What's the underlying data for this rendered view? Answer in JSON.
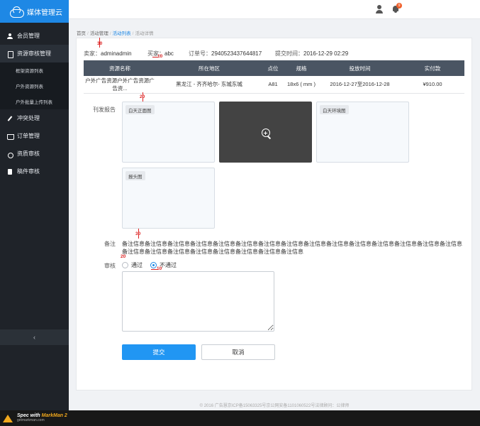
{
  "app": {
    "title": "媒体管理云"
  },
  "sidebar": {
    "items": [
      {
        "label": "会员管理",
        "icon": "user-icon"
      },
      {
        "label": "资源审核管理",
        "icon": "doc-icon"
      },
      {
        "label": "冲突处理",
        "icon": "pen-icon"
      },
      {
        "label": "订单管理",
        "icon": "cart-icon"
      },
      {
        "label": "资质审核",
        "icon": "medal-icon"
      },
      {
        "label": "稿件审核",
        "icon": "file-icon"
      }
    ],
    "sub_items": [
      "框架资源列表",
      "户外资源列表",
      "户外批量上传列表"
    ],
    "collapse_glyph": "‹"
  },
  "topbar": {
    "badge_count": "9"
  },
  "breadcrumb": {
    "home": "首页",
    "level1": "活动管理",
    "level2": "活动列表",
    "level3": "活动详情"
  },
  "order_info": {
    "seller_label": "卖家：",
    "seller": "adminadmin",
    "buyer_label": "买家：",
    "buyer": "abc",
    "order_no_label": "订单号：",
    "order_no": "2940523437644817",
    "submit_time_label": "提交时间：",
    "submit_time": "2016-12-29 02:29"
  },
  "table": {
    "headers": [
      "资源名称",
      "所在地区",
      "点位",
      "规格",
      "投放时间",
      "实付款"
    ],
    "rows": [
      [
        "户外广告资源户外广告资源广告资...",
        "黑龙江 - 齐齐哈尔- 东城东城",
        "A81",
        "18x6 ( mm )",
        "2016-12-27至2016-12-28",
        "¥910.00"
      ]
    ]
  },
  "report": {
    "label": "刊发报告",
    "images": [
      {
        "tag": "白天正面图"
      },
      {
        "tag": ""
      },
      {
        "tag": "白天环境图"
      },
      {
        "tag": "报头图"
      }
    ]
  },
  "remark": {
    "label": "备注",
    "text": "备注信息备注信息备注信息备注信息备注信息备注信息备注信息备注信息备注信息备注信息备注信息备注信息备注信息备注信息备注信息备注信息备注信息备注信息备注信息备注信息备注信息备注信息备注信息"
  },
  "review": {
    "label": "审核",
    "options": [
      "通过",
      "不通过"
    ],
    "selected": "不通过"
  },
  "buttons": {
    "submit": "提交",
    "cancel": "取消"
  },
  "footer": {
    "text": "© 2016 广告慧京ICP备15063325号京公网安备1101060522号法律顾问：公律师"
  },
  "annotations": {
    "a30_top": "30",
    "a10_top": "10",
    "a20_report": "20",
    "a30_mid": "30",
    "a20_review": "20",
    "a10_review": "10"
  },
  "markman": {
    "spec_with": "Spec with",
    "brand": "MarkMan 2",
    "site": "getmarkman.com"
  },
  "colors": {
    "primary": "#2196f3",
    "sidebar": "#1f2329",
    "brand_bar": "#1e88e5",
    "table_header": "#4a5563"
  }
}
